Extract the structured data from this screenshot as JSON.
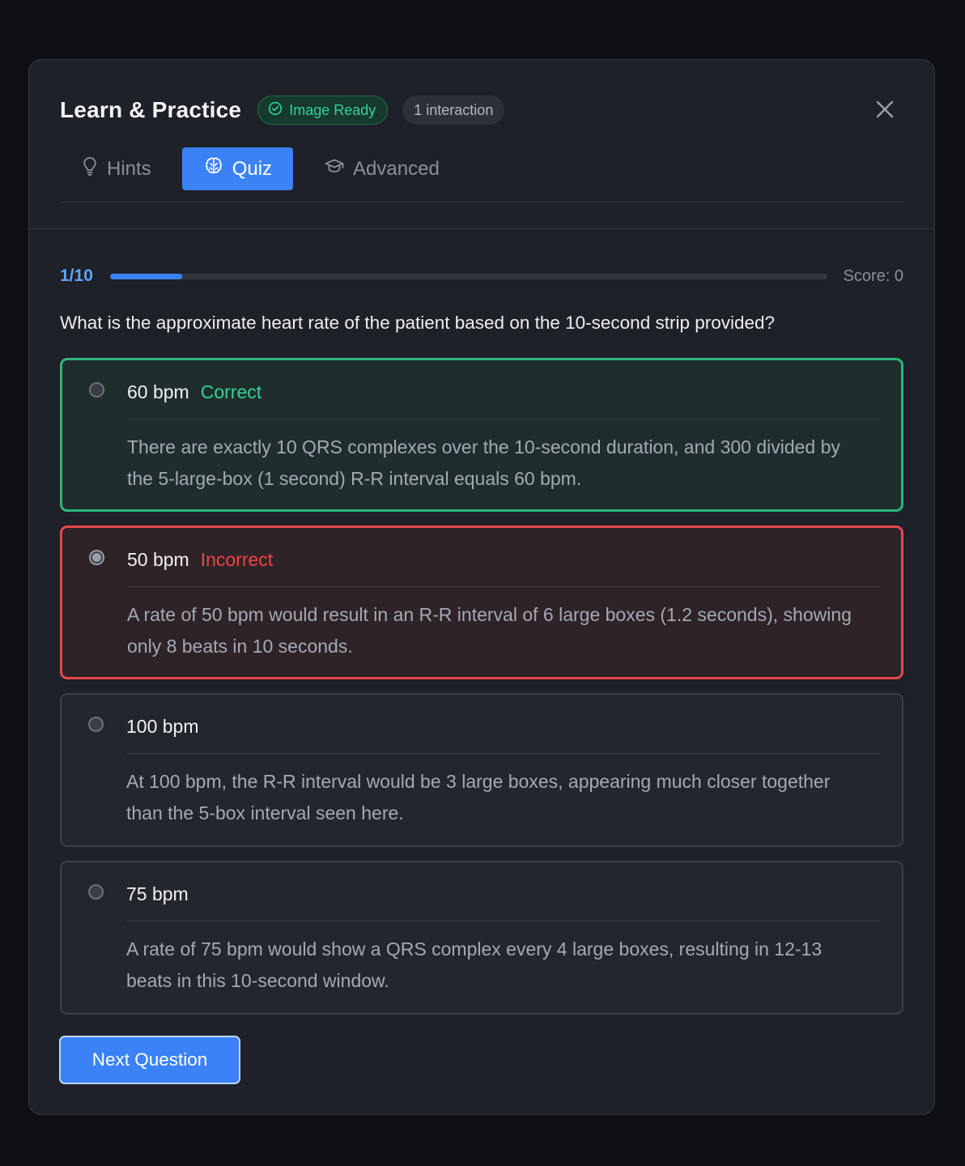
{
  "header": {
    "title": "Learn & Practice",
    "status_badge": "Image Ready",
    "interaction_badge": "1 interaction",
    "close_icon": "close-icon"
  },
  "tabs": [
    {
      "label": "Hints",
      "icon": "lightbulb-icon",
      "active": false
    },
    {
      "label": "Quiz",
      "icon": "brain-icon",
      "active": true
    },
    {
      "label": "Advanced",
      "icon": "graduation-cap-icon",
      "active": false
    }
  ],
  "quiz": {
    "progress_label": "1/10",
    "progress_fraction": 0.1,
    "score_label": "Score: 0",
    "question": "What is the approximate heart rate of the patient based on the 10-second strip provided?",
    "options": [
      {
        "label": "60 bpm",
        "status": "Correct",
        "selected": false,
        "explanation": "There are exactly 10 QRS complexes over the 10-second duration, and 300 divided by the 5-large-box (1 second) R-R interval equals 60 bpm."
      },
      {
        "label": "50 bpm",
        "status": "Incorrect",
        "selected": true,
        "explanation": "A rate of 50 bpm would result in an R-R interval of 6 large boxes (1.2 seconds), showing only 8 beats in 10 seconds."
      },
      {
        "label": "100 bpm",
        "status": "",
        "selected": false,
        "explanation": "At 100 bpm, the R-R interval would be 3 large boxes, appearing much closer together than the 5-box interval seen here."
      },
      {
        "label": "75 bpm",
        "status": "",
        "selected": false,
        "explanation": "A rate of 75 bpm would show a QRS complex every 4 large boxes, resulting in 12-13 beats in this 10-second window."
      }
    ],
    "next_button": "Next Question"
  },
  "colors": {
    "accent": "#3b82f6",
    "correct": "#34d399",
    "incorrect": "#ef4444",
    "background": "#1e2127"
  }
}
